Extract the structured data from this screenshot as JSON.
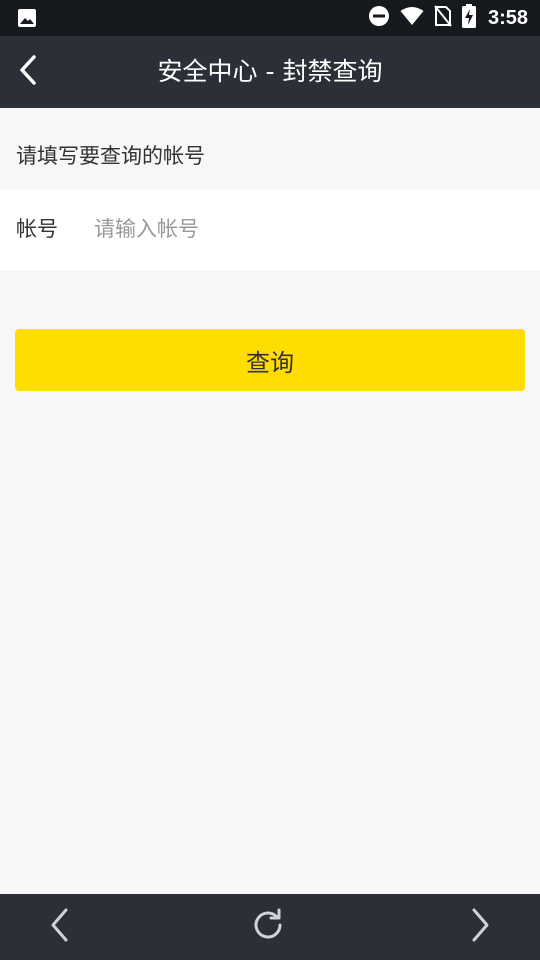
{
  "status_bar": {
    "time": "3:58",
    "icons": [
      "image-icon",
      "dnd-icon",
      "wifi-icon",
      "no-sim-icon",
      "battery-charging-icon"
    ]
  },
  "title_bar": {
    "title": "安全中心 - 封禁查询",
    "back_icon": "chevron-left-icon"
  },
  "form": {
    "hint": "请填写要查询的帐号",
    "account_label": "帐号",
    "account_placeholder": "请输入帐号",
    "account_value": ""
  },
  "query_button": {
    "label": "查询"
  },
  "nav_bar": {
    "icons": [
      "back-icon",
      "refresh-icon",
      "forward-icon"
    ]
  },
  "colors": {
    "status_bar_bg": "#16191d",
    "title_bar_bg": "#2b3038",
    "page_bg": "#f7f7f7",
    "accent_button": "#ffdd00"
  }
}
